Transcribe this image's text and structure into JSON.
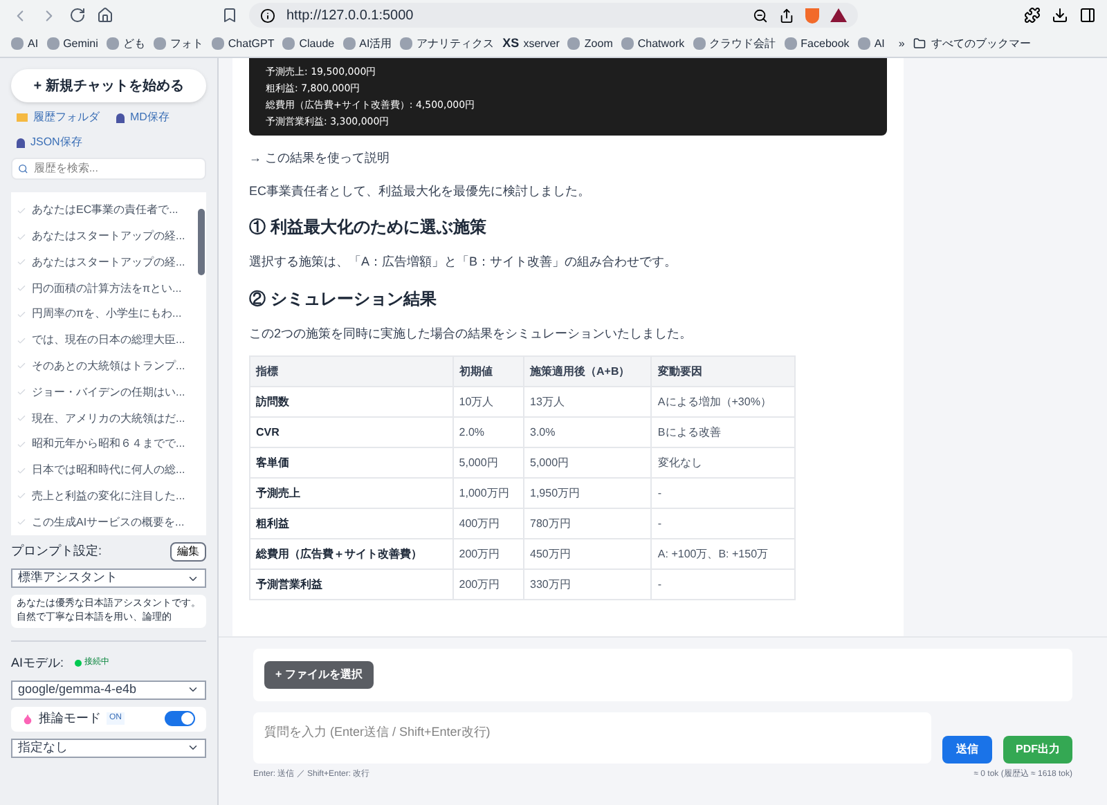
{
  "browser": {
    "url": "http://127.0.0.1:5000",
    "bookmarks": [
      "AI",
      "Gemini",
      "ども",
      "フォト",
      "ChatGPT",
      "Claude",
      "AI活用",
      "アナリティクス",
      "xserver",
      "Zoom",
      "Chatwork",
      "クラウド会計",
      "Facebook",
      "AI"
    ],
    "bookmarks_folder": "すべてのブックマー",
    "xs_logo": "XS",
    "more": "»"
  },
  "sidebar": {
    "new_chat": "+ 新規チャットを始める",
    "links": [
      "履歴フォルダ",
      "MD保存",
      "JSON保存"
    ],
    "search": {
      "placeholder": "履歴を検索..."
    },
    "history": [
      {
        "title": "あなたはEC事業の責任者で..."
      },
      {
        "title": "あなたはスタートアップの経..."
      },
      {
        "title": "あなたはスタートアップの経..."
      },
      {
        "title": "円の面積の計算方法をπとい..."
      },
      {
        "title": "円周率のπを、小学生にもわ..."
      },
      {
        "title": "では、現在の日本の総理大臣..."
      },
      {
        "title": "そのあとの大統領はトランプ..."
      },
      {
        "title": "ジョー・バイデンの任期はい..."
      },
      {
        "title": "現在、アメリカの大統領はだ..."
      },
      {
        "title": "昭和元年から昭和６４までで..."
      },
      {
        "title": "日本では昭和時代に何人の総..."
      },
      {
        "title": "売上と利益の変化に注目した..."
      },
      {
        "title": "この生成AIサービスの概要を..."
      }
    ],
    "prompt_label": "プロンプト設定:",
    "edit": "編集",
    "prompt_select": "標準アシスタント",
    "prompt_text": "あなたは優秀な日本語アシスタントです。自然で丁寧な日本語を用い、論理的",
    "model_label": "AIモデル:",
    "status": "接続中",
    "model_select": "google/gemma-4-e4b",
    "reasoning_label": "推論モード",
    "reasoning_badge": "ON",
    "reasoning_on": true,
    "effort_select": "指定なし"
  },
  "chat": {
    "code_lines": [
      "予測売上: 19,500,000円",
      "粗利益: 7,800,000円",
      "総費用（広告費+サイト改善費）: 4,500,000円",
      "予測営業利益: 3,300,000円"
    ],
    "arrow_note": "→ この結果を使って説明",
    "intro": "EC事業責任者として、利益最大化を最優先に検討しました。",
    "heading_1": "① 利益最大化のために選ぶ施策",
    "para_1": "選択する施策は、「A：広告増額」と「B：サイト改善」の組み合わせです。",
    "heading_2": "② シミュレーション結果",
    "para_2": "この2つの施策を同時に実施した場合の結果をシミュレーションいたしました。",
    "table": {
      "columns": [
        "指標",
        "初期値",
        "施策適用後（A+B）",
        "変動要因"
      ],
      "rows": [
        [
          "訪問数",
          "10万人",
          "13万人",
          "Aによる増加（+30%）"
        ],
        [
          "CVR",
          "2.0%",
          "3.0%",
          "Bによる改善"
        ],
        [
          "客単価",
          "5,000円",
          "5,000円",
          "変化なし"
        ],
        [
          "予測売上",
          "1,000万円",
          "1,950万円",
          "-"
        ],
        [
          "粗利益",
          "400万円",
          "780万円",
          "-"
        ],
        [
          "総費用（広告費＋サイト改善費）",
          "200万円",
          "450万円",
          "A: +100万、B: +150万"
        ],
        [
          "予測営業利益",
          "200万円",
          "330万円",
          "-"
        ]
      ]
    }
  },
  "composer": {
    "file_button": "+ ファイルを選択",
    "input": {
      "placeholder": "質問を入力 (Enter送信 / Shift+Enter改行)"
    },
    "send": "送信",
    "pdf": "PDF出力",
    "hint": "Enter: 送信 ／ Shift+Enter: 改行",
    "tokens": "≈ 0 tok (履歴込 ≈ 1618 tok)"
  }
}
